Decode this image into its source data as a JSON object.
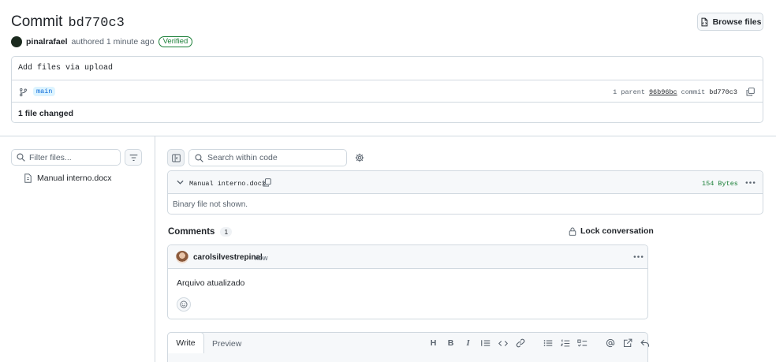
{
  "header": {
    "title_word": "Commit",
    "title_sha": "bd770c3",
    "browse_files": "Browse files",
    "author": "pinalrafael",
    "authored_text": "authored 1 minute ago",
    "verified": "Verified"
  },
  "commit": {
    "message": "Add files via upload",
    "branch": "main",
    "parent_count": "1 parent",
    "parent_sha": "96b96bc",
    "commit_label": "commit",
    "commit_sha": "bd770c3",
    "files_changed": "1 file changed"
  },
  "left_panel": {
    "filter_placeholder": "Filter files...",
    "files": [
      "Manual interno.docx"
    ]
  },
  "diff": {
    "search_placeholder": "Search within code",
    "file_name": "Manual interno.docx",
    "size": "154 Bytes",
    "binary_note": "Binary file not shown."
  },
  "comments": {
    "title": "Comments",
    "count": "1",
    "lock_label": "Lock conversation",
    "items": [
      {
        "author": "carolsilvestrepinal",
        "time": "now",
        "body": "Arquivo atualizado"
      }
    ]
  },
  "editor": {
    "tab_write": "Write",
    "tab_preview": "Preview",
    "heading_glyph": "H",
    "bold_glyph": "B",
    "italic_glyph": "I"
  },
  "colors": {
    "accent": "#0969da",
    "success": "#1a7f37",
    "border": "#d1d9e0",
    "muted": "#59636e"
  }
}
